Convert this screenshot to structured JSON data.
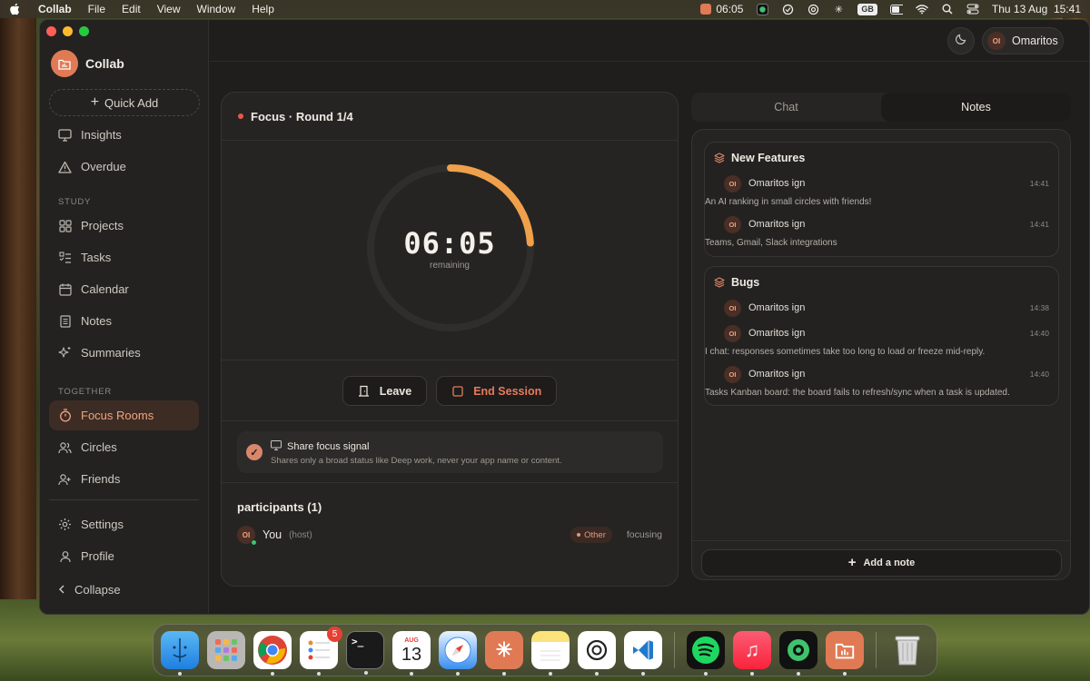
{
  "menubar": {
    "app_name": "Collab",
    "menus": [
      "File",
      "Edit",
      "View",
      "Window",
      "Help"
    ],
    "timer": "06:05",
    "input_source": "GB",
    "clock": "Thu 13 Aug  15:41"
  },
  "sidebar": {
    "brand": "Collab",
    "quick_add": "Quick Add",
    "top_items": [
      {
        "label": "Insights",
        "icon": "insights-icon"
      },
      {
        "label": "Overdue",
        "icon": "warning-icon"
      }
    ],
    "study_label": "STUDY",
    "study_items": [
      {
        "label": "Projects",
        "icon": "grid-icon"
      },
      {
        "label": "Tasks",
        "icon": "checklist-icon"
      },
      {
        "label": "Calendar",
        "icon": "calendar-icon"
      },
      {
        "label": "Notes",
        "icon": "notes-icon"
      },
      {
        "label": "Summaries",
        "icon": "sparkle-icon"
      }
    ],
    "together_label": "TOGETHER",
    "together_items": [
      {
        "label": "Focus Rooms",
        "icon": "timer-icon",
        "active": true
      },
      {
        "label": "Circles",
        "icon": "users-icon"
      },
      {
        "label": "Friends",
        "icon": "user-icon"
      }
    ],
    "bottom_items": [
      {
        "label": "Settings",
        "icon": "gear-icon"
      },
      {
        "label": "Profile",
        "icon": "profile-icon"
      }
    ],
    "collapse": "Collapse"
  },
  "topbar": {
    "user_initials": "OI",
    "user_name": "Omaritos"
  },
  "focus": {
    "title": "Focus · Round 1/4",
    "time": "06:05",
    "time_sub": "remaining",
    "progress": 0.24,
    "leave": "Leave",
    "end_session": "End Session",
    "share_title": "Share focus signal",
    "share_desc": "Shares only a broad status like Deep work, never your app name or content.",
    "participants_title": "participants (1)",
    "participant": {
      "initials": "OI",
      "name": "You",
      "role": "(host)",
      "tag": "Other",
      "status": "focusing"
    }
  },
  "tabs": [
    "Chat",
    "Notes"
  ],
  "active_tab": "Notes",
  "notes": {
    "groups": [
      {
        "title": "New Features",
        "entries": [
          {
            "initials": "OI",
            "author": "Omaritos ign",
            "time": "14:41",
            "text": "An AI ranking in small circles with friends!"
          },
          {
            "initials": "OI",
            "author": "Omaritos ign",
            "time": "14:41",
            "text": "Teams, Gmail, Slack integrations"
          }
        ]
      },
      {
        "title": "Bugs",
        "entries": [
          {
            "initials": "OI",
            "author": "Omaritos ign",
            "time": "14:38",
            "text": ""
          },
          {
            "initials": "OI",
            "author": "Omaritos ign",
            "time": "14:40",
            "text": "I chat: responses sometimes take too long to load or freeze mid-reply."
          },
          {
            "initials": "OI",
            "author": "Omaritos ign",
            "time": "14:40",
            "text": "Tasks Kanban board: the board fails to refresh/sync when a task is updated."
          }
        ]
      }
    ],
    "add_note": "Add a note"
  },
  "dock": {
    "calendar_month": "AUG",
    "calendar_day": "13",
    "reminders_badge": "5"
  },
  "colors": {
    "accent": "#e07a55",
    "timer_arc": "#f0a04b",
    "background": "#1f1e1d"
  }
}
